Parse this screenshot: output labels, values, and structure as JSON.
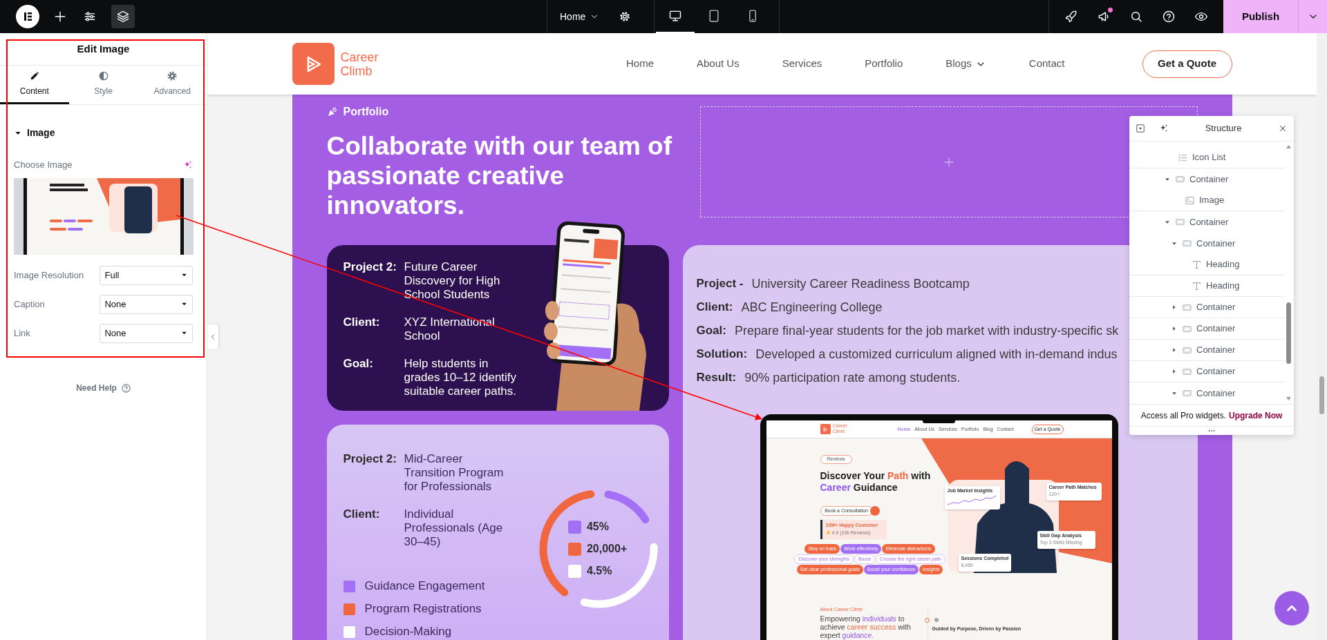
{
  "top_bar": {
    "page_menu": "Home",
    "devices": [
      {
        "kind": "desktop",
        "selected": true
      },
      {
        "kind": "tablet",
        "selected": false
      },
      {
        "kind": "mobile",
        "selected": false
      }
    ],
    "notification": true,
    "publish": "Publish"
  },
  "panel": {
    "title": "Edit Image",
    "tabs": [
      {
        "label": "Content",
        "kind": "pencil",
        "selected": true
      },
      {
        "label": "Style",
        "kind": "contrast",
        "selected": false
      },
      {
        "label": "Advanced",
        "kind": "gear",
        "selected": false
      }
    ],
    "section": {
      "title": "Image",
      "expanded": true
    },
    "choose_label": "Choose Image",
    "fields": [
      {
        "label": "Image Resolution",
        "value": "Full"
      },
      {
        "label": "Caption",
        "value": "None"
      },
      {
        "label": "Link",
        "value": "None"
      }
    ],
    "help": "Need Help"
  },
  "site_header": {
    "logo": "Career Climb",
    "nav": [
      {
        "label": "Home",
        "dropdown": false
      },
      {
        "label": "About Us",
        "dropdown": false
      },
      {
        "label": "Services",
        "dropdown": false
      },
      {
        "label": "Portfolio",
        "dropdown": false
      },
      {
        "label": "Blogs",
        "dropdown": true
      },
      {
        "label": "Contact",
        "dropdown": false
      }
    ],
    "cta": "Get a Quote"
  },
  "portfolio": {
    "eyebrow": "Portfolio",
    "heading": "Collaborate with our team of passionate creative innovators.",
    "card_1": {
      "rows": [
        {
          "label": "Project 2:",
          "value": "Future Career Discovery for High School Students"
        },
        {
          "label": "Client:",
          "value": "XYZ International School"
        },
        {
          "label": "Goal:",
          "value": "Help students in grades 10–12 identify suitable career paths."
        }
      ]
    },
    "card_2": {
      "rows": [
        {
          "label": "Project 2:",
          "value": "Mid-Career Transition Program for Professionals"
        },
        {
          "label": "Client:",
          "value": "Individual Professionals (Age 30–45)"
        }
      ],
      "stats": [
        {
          "value": "45%",
          "color": "#a36ff5"
        },
        {
          "value": "20,000+",
          "color": "#f0663f"
        },
        {
          "value": "4.5%",
          "color": "#ffffff"
        }
      ],
      "legend": [
        {
          "label": "Guidance Engagement",
          "color": "#a36ff5"
        },
        {
          "label": "Program Registrations",
          "color": "#f0663f"
        },
        {
          "label": "Decision-Making",
          "color": "#ffffff"
        }
      ]
    },
    "card_3": {
      "rows": [
        {
          "label": "Project -",
          "value": "University Career Readiness Bootcamp"
        },
        {
          "label": "Client:",
          "value": "ABC Engineering College"
        },
        {
          "label": "Goal:",
          "value": "Prepare final-year students for the job market with industry-specific sk"
        },
        {
          "label": "Solution:",
          "value": "Developed a customized curriculum aligned with in-demand indus"
        },
        {
          "label": "Result:",
          "value": "90% participation rate among students."
        }
      ]
    }
  },
  "mockup": {
    "logo": "Career Climb",
    "nav": [
      {
        "label": "Home",
        "selected": true
      },
      {
        "label": "About Us",
        "selected": false
      },
      {
        "label": "Services",
        "selected": false
      },
      {
        "label": "Portfolio",
        "selected": false
      },
      {
        "label": "Blog",
        "selected": false
      },
      {
        "label": "Contact",
        "selected": false
      }
    ],
    "cta": "Get a Quote",
    "badge": "Reviews",
    "headline": [
      {
        "text": "Discover Your ",
        "color": "#1b1b1b"
      },
      {
        "text": "Path",
        "color": "#f0663f"
      },
      {
        "text": " with ",
        "color": "#1b1b1b"
      },
      {
        "text": "Career",
        "color": "#8f55f0"
      },
      {
        "text": " Guidance",
        "color": "#1b1b1b"
      }
    ],
    "button": "Book a Consultation",
    "customers": "10M+ Happy Customer",
    "rating": "4.9 (10k Reviews)",
    "chip_rows": [
      [
        {
          "label": "Stay on track",
          "kind": "orange"
        },
        {
          "label": "Work effectively",
          "kind": "purple"
        },
        {
          "label": "Eliminate distractions",
          "kind": "orange"
        }
      ],
      [
        {
          "label": "Discover your strengths",
          "kind": "outline"
        },
        {
          "label": "Boost",
          "kind": "outline"
        },
        {
          "label": "Choose the right career path",
          "kind": "outline"
        }
      ],
      [
        {
          "label": "Set clear professional goals",
          "kind": "orange"
        },
        {
          "label": "Boost your confidence",
          "kind": "purple"
        },
        {
          "label": "Insights",
          "kind": "orange"
        }
      ]
    ],
    "floating_cards": [
      {
        "title": "Job Market Insights",
        "kind": "chart"
      },
      {
        "title": "Career Path Matches",
        "value": "120+",
        "kind": "stat"
      },
      {
        "title": "Skill Gap Analysis",
        "value": "Top 3 Skills Missing",
        "kind": "stat"
      },
      {
        "title": "Sessions Completed",
        "value": "8,450",
        "kind": "stat"
      }
    ],
    "about_label": "About Career Climb",
    "about_heading": [
      {
        "text": "Empowering ",
        "color": "#444444"
      },
      {
        "text": "individuals",
        "color": "#8f55f0"
      },
      {
        "text": " to achieve ",
        "color": "#444444"
      },
      {
        "text": "career success",
        "color": "#f0663f"
      },
      {
        "text": " with expert ",
        "color": "#444444"
      },
      {
        "text": "guidance.",
        "color": "#8f55f0"
      }
    ],
    "feature_title": "Guided by Purpose, Driven by Passion"
  },
  "structure": {
    "title": "Structure",
    "tree": [
      {
        "label": "Icon List",
        "kind": "list"
      },
      {
        "label": "Container",
        "kind": "container",
        "expanded": true,
        "children": [
          {
            "label": "Image",
            "kind": "image"
          }
        ]
      },
      {
        "label": "Container",
        "kind": "container",
        "expanded": true,
        "children": [
          {
            "label": "Container",
            "kind": "container",
            "expanded": true,
            "children": [
              {
                "label": "Heading",
                "kind": "heading"
              },
              {
                "label": "Heading",
                "kind": "heading"
              }
            ]
          },
          {
            "label": "Container",
            "kind": "container",
            "expanded": false
          },
          {
            "label": "Container",
            "kind": "container",
            "expanded": false
          },
          {
            "label": "Container",
            "kind": "container",
            "expanded": false
          },
          {
            "label": "Container",
            "kind": "container",
            "expanded": false
          },
          {
            "label": "Container",
            "kind": "container",
            "expanded": true
          }
        ]
      }
    ],
    "promo": "Access all Pro widgets.",
    "promo_link": "Upgrade Now"
  }
}
